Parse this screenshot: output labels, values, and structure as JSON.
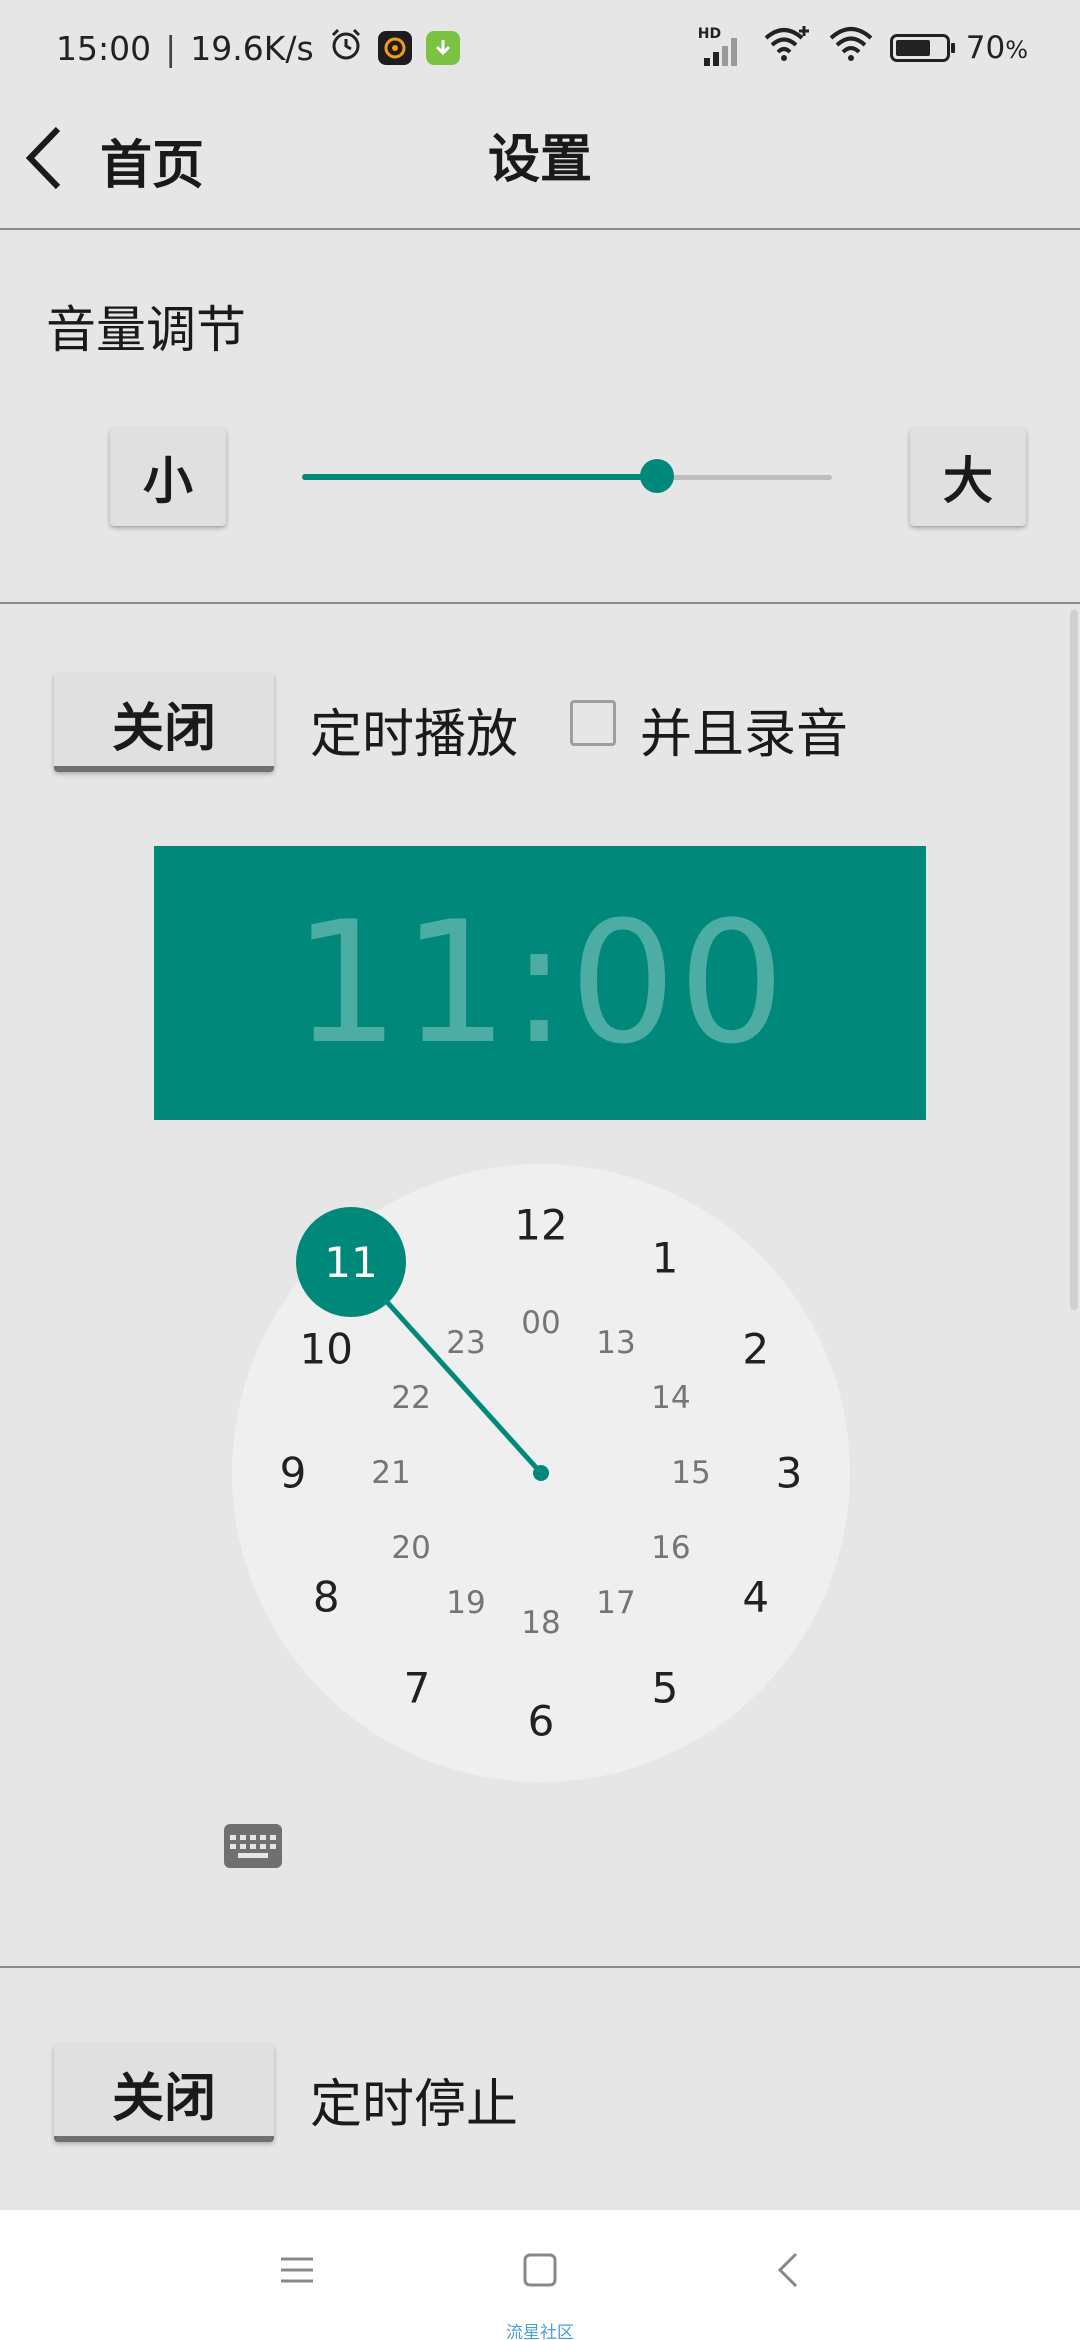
{
  "status_bar": {
    "time": "15:00",
    "network_speed": "19.6K/s",
    "signal_label": "HD",
    "battery": "70",
    "battery_unit": "%",
    "battery_level": 0.7
  },
  "header": {
    "back_label": "首页",
    "title": "设置"
  },
  "volume": {
    "label": "音量调节",
    "decrease_label": "小",
    "increase_label": "大",
    "level": 0.67,
    "accent_color": "#00897b"
  },
  "timed_play": {
    "toggle_label": "关闭",
    "label": "定时播放",
    "record_label": "并且录音",
    "record_checked": false
  },
  "time_picker": {
    "display_time": "11:00",
    "selected_hour": "11",
    "outer_hours": [
      "12",
      "1",
      "2",
      "3",
      "4",
      "5",
      "6",
      "7",
      "8",
      "9",
      "10",
      "11"
    ],
    "inner_hours": [
      "00",
      "13",
      "14",
      "15",
      "16",
      "17",
      "18",
      "19",
      "20",
      "21",
      "22",
      "23"
    ],
    "keyboard_icon": "keyboard-icon"
  },
  "timed_stop": {
    "toggle_label": "关闭",
    "label": "定时停止"
  },
  "nav_bar": {
    "menu_icon": "menu-icon",
    "home_icon": "home-icon",
    "back_icon": "back-icon",
    "watermark": "流星社区"
  }
}
